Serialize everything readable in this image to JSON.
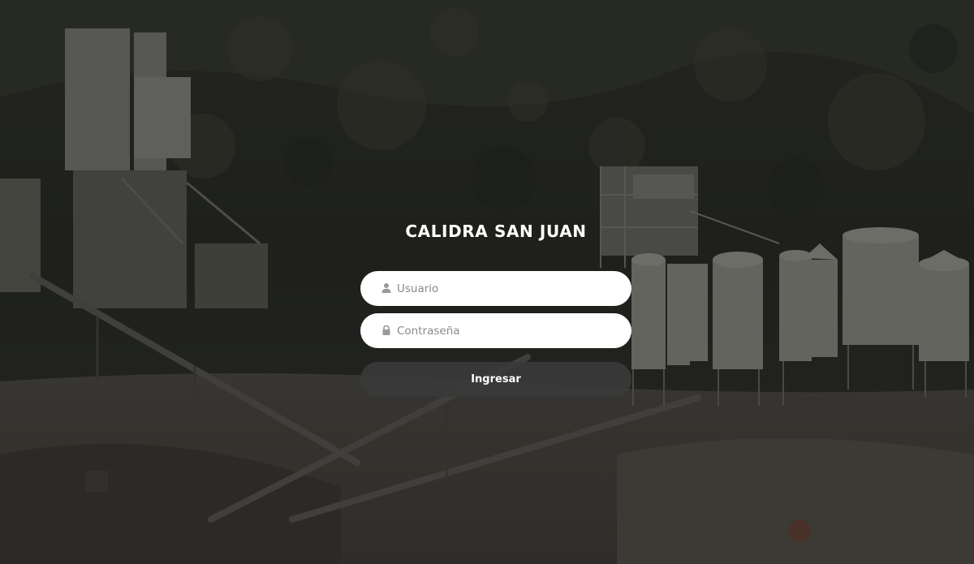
{
  "app": {
    "title": "CALIDRA SAN JUAN"
  },
  "form": {
    "username_placeholder": "Usuario",
    "username_value": "",
    "username_icon": "user-icon",
    "password_placeholder": "Contraseña",
    "password_value": "",
    "password_icon": "lock-icon",
    "submit_label": "Ingresar"
  },
  "colors": {
    "background_dark": "#2a2a27",
    "field_background": "#ffffff",
    "button_background": "#3a3a3a",
    "title_text": "#ffffff"
  }
}
